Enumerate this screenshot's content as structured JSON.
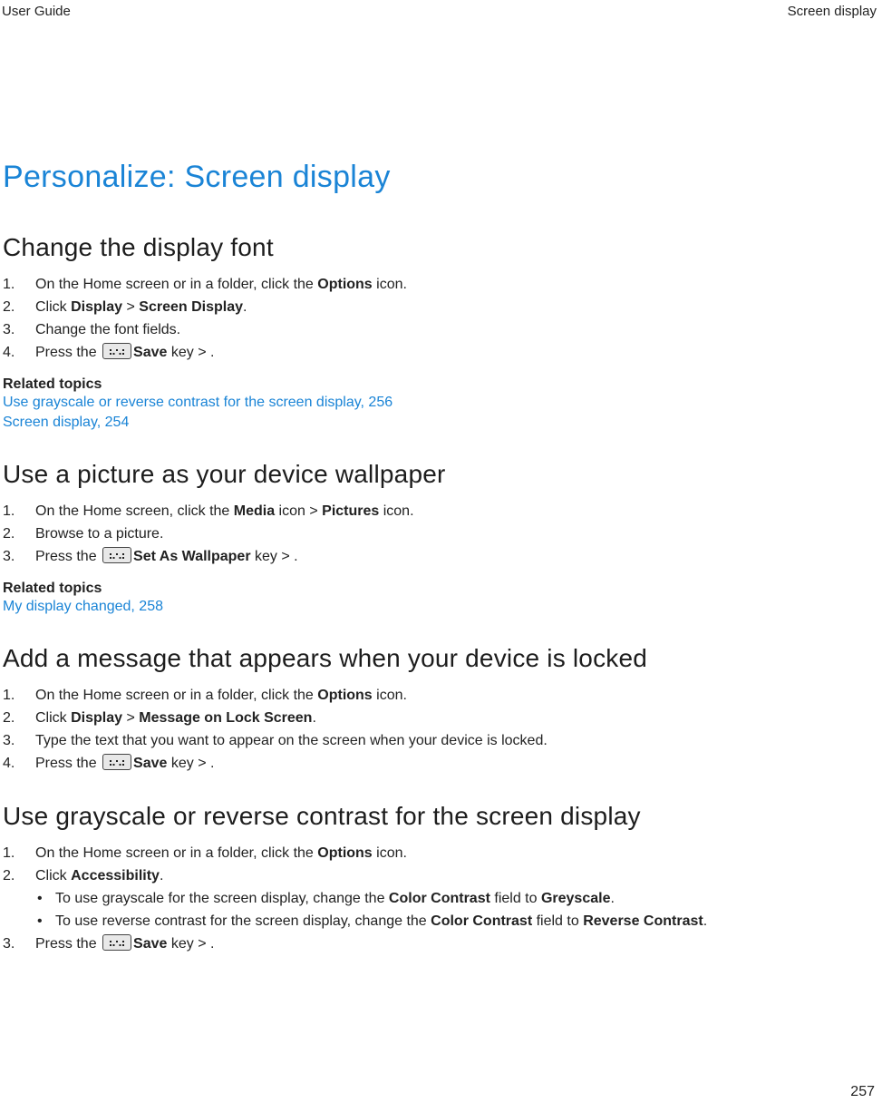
{
  "header": {
    "left": "User Guide",
    "right": "Screen display"
  },
  "h1": "Personalize: Screen display",
  "sections": [
    {
      "title": "Change the display font",
      "steps": [
        {
          "pre": "On the Home screen or in a folder, click the ",
          "b1": "Options",
          "post": " icon."
        },
        {
          "pre": "Click ",
          "b1": "Display",
          "mid": " > ",
          "b2": "Screen Display",
          "post": "."
        },
        {
          "pre": "Change the font fields."
        },
        {
          "pre": "Press the ",
          "icon": true,
          "mid": " key > ",
          "b1": "Save",
          "post": "."
        }
      ],
      "related_label": "Related topics",
      "related": [
        "Use grayscale or reverse contrast for the screen display, 256",
        "Screen display, 254"
      ]
    },
    {
      "title": "Use a picture as your device wallpaper",
      "steps": [
        {
          "pre": "On the Home screen, click the ",
          "b1": "Media",
          "mid": " icon > ",
          "b2": "Pictures",
          "post": " icon."
        },
        {
          "pre": "Browse to a picture."
        },
        {
          "pre": "Press the ",
          "icon": true,
          "mid": " key > ",
          "b1": "Set As Wallpaper",
          "post": "."
        }
      ],
      "related_label": "Related topics",
      "related": [
        "My display changed, 258"
      ]
    },
    {
      "title": "Add a message that appears when your device is locked",
      "steps": [
        {
          "pre": "On the Home screen or in a folder, click the ",
          "b1": "Options",
          "post": " icon."
        },
        {
          "pre": "Click ",
          "b1": "Display",
          "mid": " > ",
          "b2": "Message on Lock Screen",
          "post": "."
        },
        {
          "pre": "Type the text that you want to appear on the screen when your device is locked."
        },
        {
          "pre": "Press the ",
          "icon": true,
          "mid": " key > ",
          "b1": "Save",
          "post": "."
        }
      ]
    },
    {
      "title": "Use grayscale or reverse contrast for the screen display",
      "steps": [
        {
          "pre": "On the Home screen or in a folder, click the ",
          "b1": "Options",
          "post": " icon."
        },
        {
          "pre": "Click ",
          "b1": "Accessibility",
          "post": ".",
          "sub": [
            {
              "pre": "To use grayscale for the screen display, change the ",
              "b1": "Color Contrast",
              "mid": " field to ",
              "b2": "Greyscale",
              "post": "."
            },
            {
              "pre": "To use reverse contrast for the screen display, change the ",
              "b1": "Color Contrast",
              "mid": " field to ",
              "b2": "Reverse Contrast",
              "post": "."
            }
          ]
        },
        {
          "pre": "Press the ",
          "icon": true,
          "mid": " key > ",
          "b1": "Save",
          "post": "."
        }
      ]
    }
  ],
  "page_number": "257"
}
